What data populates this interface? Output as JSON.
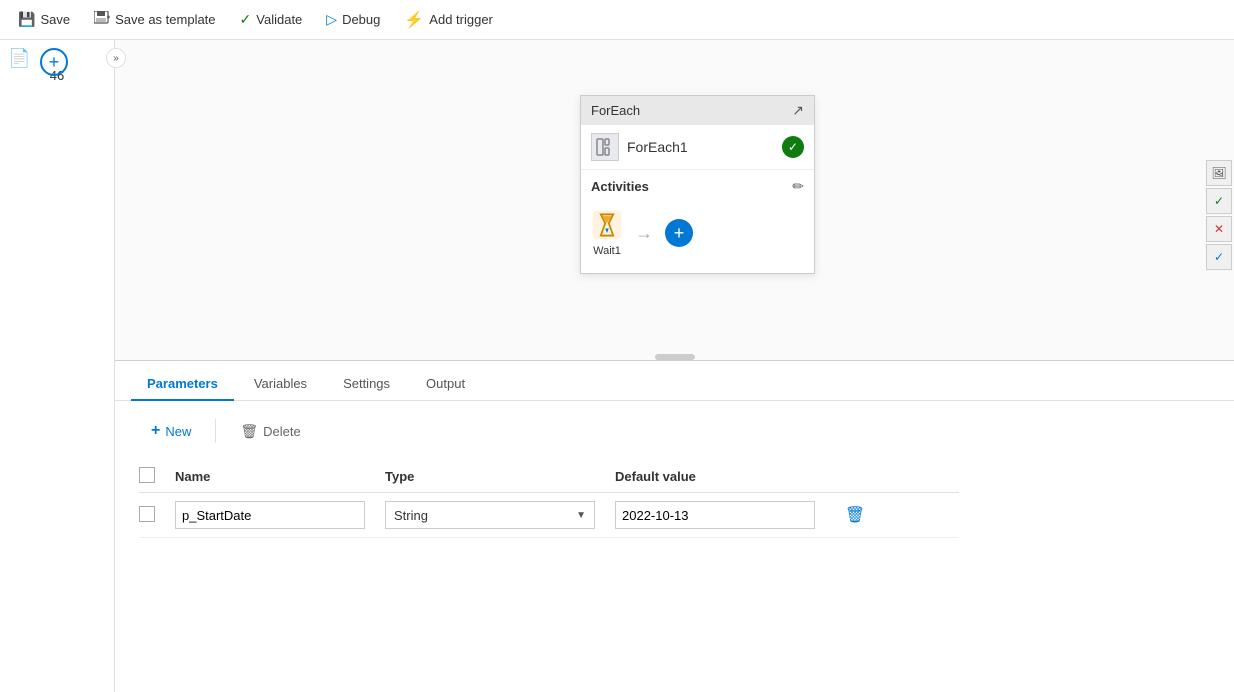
{
  "toolbar": {
    "save_label": "Save",
    "save_template_label": "Save as template",
    "validate_label": "Validate",
    "debug_label": "Debug",
    "add_trigger_label": "Add trigger"
  },
  "sidebar": {
    "chevron": "»",
    "number": "46",
    "add_icon": "+"
  },
  "foreach_card": {
    "title": "ForEach",
    "name": "ForEach1",
    "activities_label": "Activities",
    "wait_label": "Wait1",
    "expand_icon": "↗"
  },
  "tabs": [
    {
      "id": "parameters",
      "label": "Parameters",
      "active": true
    },
    {
      "id": "variables",
      "label": "Variables",
      "active": false
    },
    {
      "id": "settings",
      "label": "Settings",
      "active": false
    },
    {
      "id": "output",
      "label": "Output",
      "active": false
    }
  ],
  "params_toolbar": {
    "new_label": "New",
    "delete_label": "Delete"
  },
  "table": {
    "headers": {
      "name": "Name",
      "type": "Type",
      "default_value": "Default value"
    },
    "rows": [
      {
        "name": "p_StartDate",
        "type": "String",
        "default_value": "2022-10-13"
      }
    ]
  },
  "right_panel_buttons": [
    {
      "id": "image",
      "icon": "🖼"
    },
    {
      "id": "check-green",
      "icon": "✓"
    },
    {
      "id": "x-red",
      "icon": "✕"
    },
    {
      "id": "check-blue",
      "icon": "✓"
    }
  ],
  "colors": {
    "blue": "#0078d4",
    "green": "#107c10",
    "red": "#d13438"
  }
}
